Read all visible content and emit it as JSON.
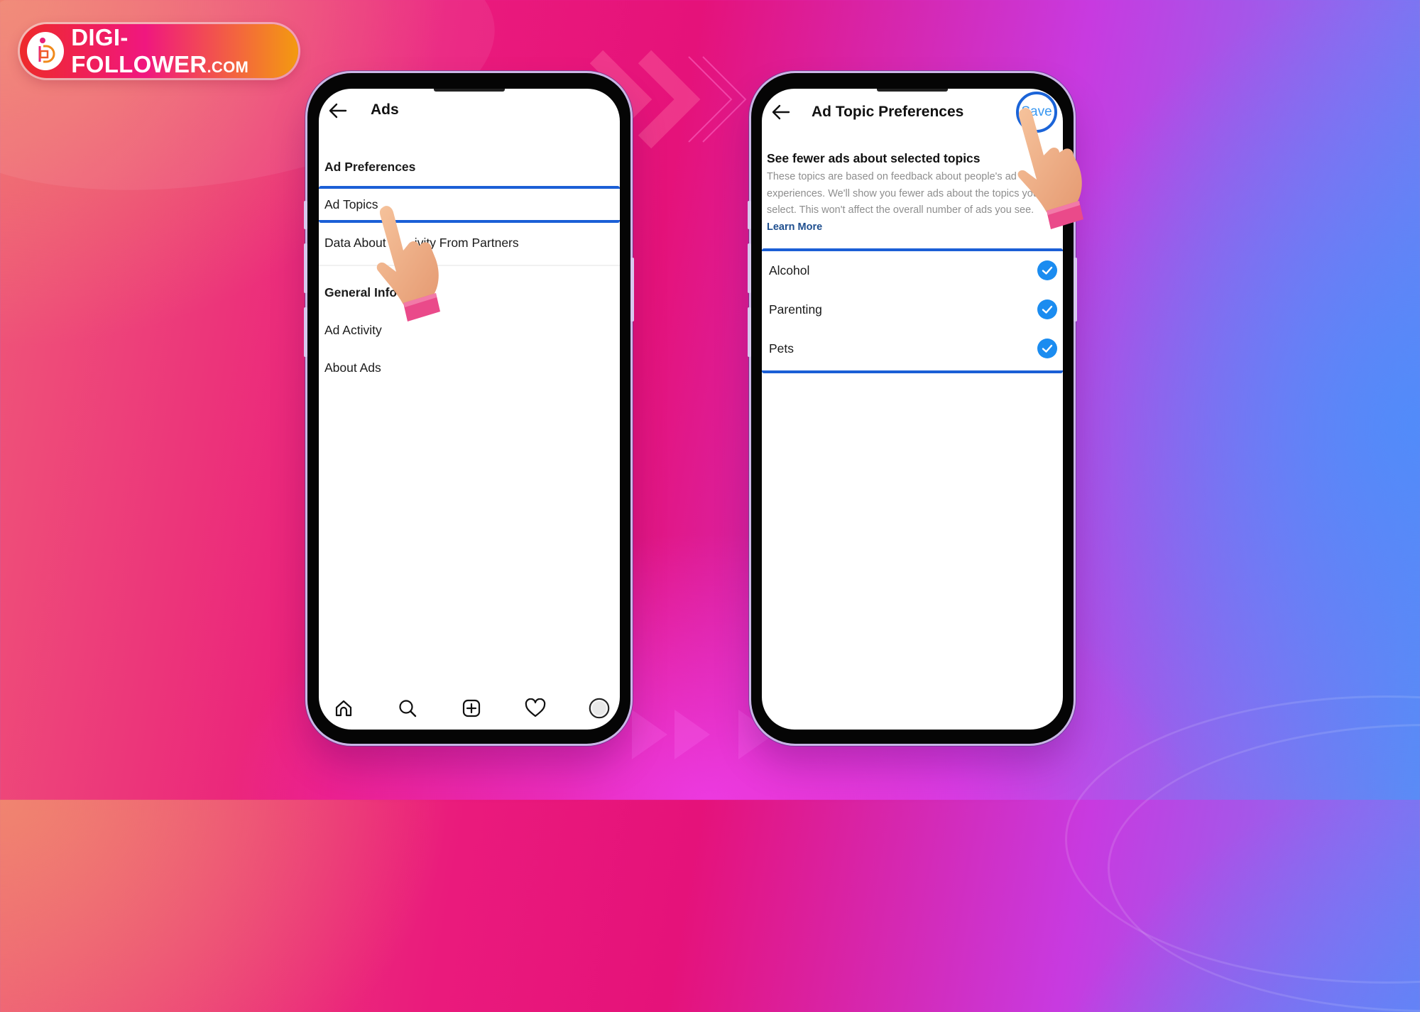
{
  "brand": {
    "logo_text": "DIGI-FOLLOWER",
    "logo_suffix": ".COM",
    "colors": {
      "red": "#ee2a2a",
      "pink": "#f0177f",
      "orange": "#f39a10"
    }
  },
  "left_screen": {
    "title": "Ads",
    "back_icon": "arrow-left-icon",
    "items": [
      {
        "label": "Ad Preferences",
        "type": "section"
      },
      {
        "label": "Ad Topics",
        "type": "item",
        "highlighted": true
      },
      {
        "label": "Data About Your Activity From Partners",
        "type": "item",
        "visible_label": "Data About Y     ivity From Partners"
      },
      {
        "label": "General Info",
        "type": "section"
      },
      {
        "label": "Ad Activity",
        "type": "item"
      },
      {
        "label": "About Ads",
        "type": "item"
      }
    ],
    "bottom_nav": [
      {
        "name": "home",
        "icon": "home-icon"
      },
      {
        "name": "search",
        "icon": "search-icon"
      },
      {
        "name": "create",
        "icon": "plus-square-icon"
      },
      {
        "name": "activity",
        "icon": "heart-icon"
      },
      {
        "name": "profile",
        "icon": "avatar-icon"
      }
    ]
  },
  "right_screen": {
    "title": "Ad Topic Preferences",
    "back_icon": "arrow-left-icon",
    "save_label": "Save",
    "section_title": "See fewer ads about selected topics",
    "description": "These topics are based on feedback about people's ad experiences. We'll show you fewer ads about the topics you select. This won't affect the overall number of ads you see.",
    "learn_more": "Learn More",
    "topics": [
      {
        "label": "Alcohol",
        "checked": true
      },
      {
        "label": "Parenting",
        "checked": true
      },
      {
        "label": "Pets",
        "checked": true
      }
    ]
  },
  "colors": {
    "highlight_blue": "#1b5fd6",
    "check_blue": "#1b8cf0",
    "save_text": "#3897f0",
    "link": "#1f4f8f"
  }
}
